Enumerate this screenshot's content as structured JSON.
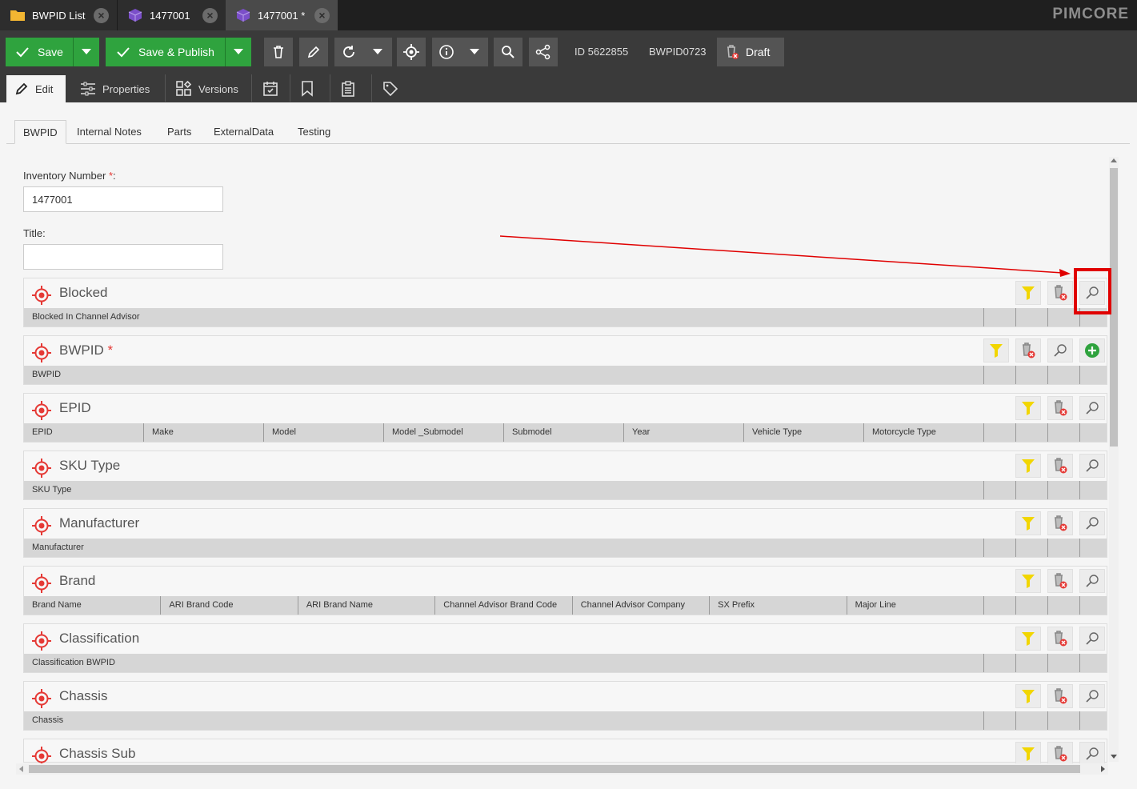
{
  "top_tabs": [
    {
      "label": "BWPID List",
      "icon": "folder-icon"
    },
    {
      "label": "1477001",
      "icon": "cube-icon"
    },
    {
      "label": "1477001 *",
      "icon": "cube-icon"
    }
  ],
  "brand": "PIMCORE",
  "toolbar": {
    "save_label": "Save",
    "save_publish_label": "Save & Publish",
    "id_text": "ID 5622855",
    "key_text": "BWPID0723",
    "status_label": "Draft"
  },
  "sub_tabs": {
    "edit": "Edit",
    "properties": "Properties",
    "versions": "Versions"
  },
  "inner_tabs": [
    "BWPID",
    "Internal Notes",
    "Parts",
    "ExternalData",
    "Testing"
  ],
  "form": {
    "inventory_label": "Inventory Number ",
    "inventory_required": "*",
    "inventory_colon": ":",
    "inventory_value": "1477001",
    "title_label": "Title:",
    "title_value": ""
  },
  "panels": [
    {
      "title": "Blocked",
      "required": "",
      "columns": [
        "Blocked In Channel Advisor"
      ]
    },
    {
      "title": "BWPID",
      "required": "*",
      "columns": [
        "BWPID"
      ]
    },
    {
      "title": "EPID",
      "required": "",
      "columns": [
        "EPID",
        "Make",
        "Model",
        "Model _Submodel",
        "Submodel",
        "Year",
        "Vehicle Type",
        "Motorcycle Type"
      ]
    },
    {
      "title": "SKU Type",
      "required": "",
      "columns": [
        "SKU Type"
      ]
    },
    {
      "title": "Manufacturer",
      "required": "",
      "columns": [
        "Manufacturer"
      ]
    },
    {
      "title": "Brand",
      "required": "",
      "columns": [
        "Brand Name",
        "ARI Brand Code",
        "ARI Brand Name",
        "Channel Advisor Brand Code",
        "Channel Advisor Company",
        "SX Prefix",
        "Major Line"
      ]
    },
    {
      "title": "Classification",
      "required": "",
      "columns": [
        "Classification BWPID"
      ]
    },
    {
      "title": "Chassis",
      "required": "",
      "columns": [
        "Chassis"
      ]
    },
    {
      "title": "Chassis Sub",
      "required": "",
      "columns": []
    }
  ],
  "colors": {
    "accent_green": "#2fa33e",
    "highlight_red": "#e00000",
    "target_red": "#e53935",
    "filter_yellow": "#f2d600"
  }
}
